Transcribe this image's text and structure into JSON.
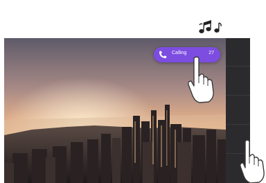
{
  "call_notification": {
    "label": "Calling",
    "count": "27",
    "accent": "#7c4de0"
  },
  "icons": {
    "sound": "music-notes-icon",
    "call": "phone-icon",
    "tap": "tap-hand-icon",
    "swipe": "swipe-hand-icon"
  }
}
